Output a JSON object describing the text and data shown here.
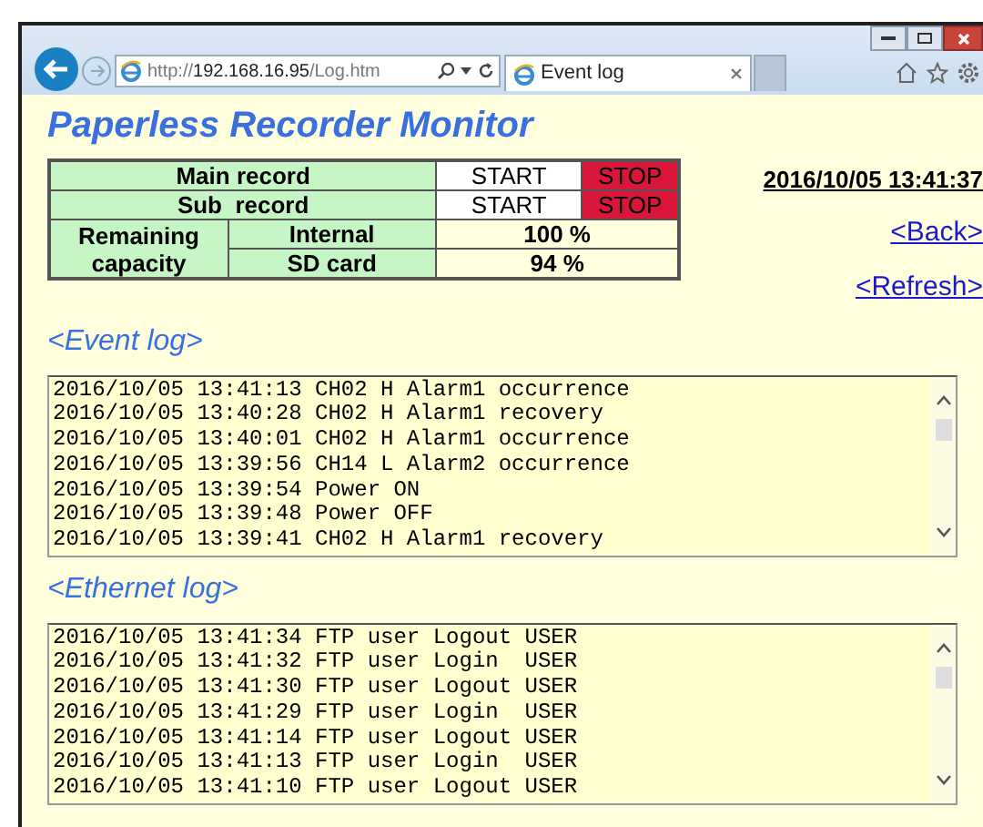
{
  "browser": {
    "address": "http://**192.168.16.95**/Log.htm",
    "tab": {
      "title": "Event log"
    }
  },
  "title": "Paperless Recorder Monitor",
  "records": [
    {
      "label": "Main record",
      "start": "START",
      "stop": "STOP",
      "stopped": true
    },
    {
      "label": "Sub  record",
      "start": "START",
      "stop": "STOP",
      "stopped": true
    }
  ],
  "capacity": {
    "label": "Remaining capacity",
    "rows": [
      {
        "label": "Internal",
        "value": "100 %"
      },
      {
        "label": "SD card",
        "value": "94 %"
      }
    ]
  },
  "datetime": "2016/10/05 13:41:37",
  "links": [
    "<Back>",
    "<Refresh>"
  ],
  "logs": [
    {
      "title": "<Event log>",
      "lines": [
        "2016/10/05 13:41:13 CH02 H Alarm1 occurrence",
        "2016/10/05 13:40:28 CH02 H Alarm1 recovery",
        "2016/10/05 13:40:01 CH02 H Alarm1 occurrence",
        "2016/10/05 13:39:56 CH14 L Alarm2 occurrence",
        "2016/10/05 13:39:54 Power ON",
        "2016/10/05 13:39:48 Power OFF",
        "2016/10/05 13:39:41 CH02 H Alarm1 recovery"
      ]
    },
    {
      "title": "<Ethernet log>",
      "lines": [
        "2016/10/05 13:41:34 FTP user Logout USER",
        "2016/10/05 13:41:32 FTP user Login  USER",
        "2016/10/05 13:41:30 FTP user Logout USER",
        "2016/10/05 13:41:29 FTP user Login  USER",
        "2016/10/05 13:41:14 FTP user Logout USER",
        "2016/10/05 13:41:13 FTP user Login  USER",
        "2016/10/05 13:41:10 FTP user Logout USER"
      ]
    }
  ]
}
